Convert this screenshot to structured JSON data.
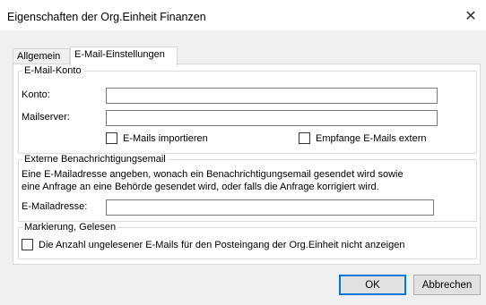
{
  "window": {
    "title": "Eigenschaften der Org.Einheit Finanzen",
    "close_glyph": "✕"
  },
  "tabs": [
    {
      "label": "Allgemein",
      "active": false
    },
    {
      "label": "E-Mail-Einstellungen",
      "active": true
    }
  ],
  "mail_account": {
    "legend": "E-Mail-Konto",
    "account_label": "Konto:",
    "account_value": "",
    "server_label": "Mailserver:",
    "server_value": "",
    "import_checkbox": {
      "label": "E-Mails importieren",
      "checked": false
    },
    "external_checkbox": {
      "label": "Empfange E-Mails extern",
      "checked": false
    }
  },
  "external_notification": {
    "legend": "Externe Benachrichtigungsemail",
    "description_line1": "Eine E-Mailadresse angeben, wonach ein Benachrichtigungsemail gesendet wird sowie",
    "description_line2": "eine Anfrage an eine Behörde gesendet wird, oder falls die Anfrage korrigiert wird.",
    "email_label": "E-Mailadresse:",
    "email_value": ""
  },
  "marking": {
    "legend": "Markierung, Gelesen",
    "hide_unread_checkbox": {
      "label": "Die Anzahl ungelesener E-Mails für den Posteingang der Org.Einheit nicht anzeigen",
      "checked": false
    }
  },
  "buttons": {
    "ok_label": "OK",
    "cancel_label": "Abbrechen"
  },
  "colors": {
    "accent": "#0078d7",
    "client_bg": "#f0f0f0"
  }
}
